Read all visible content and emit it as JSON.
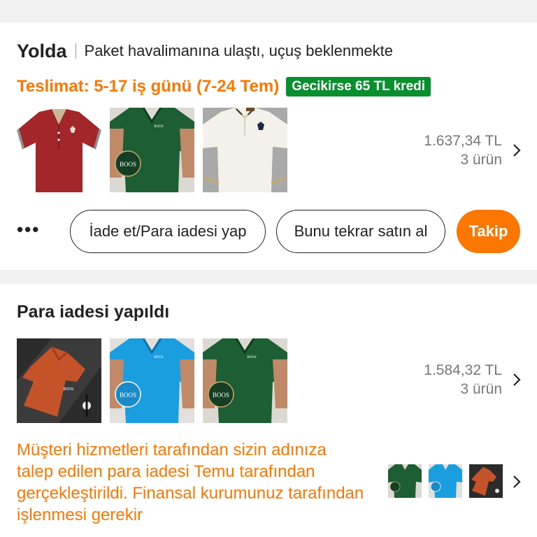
{
  "order1": {
    "status": "Yolda",
    "status_detail": "Paket havalimanına ulaştı, uçuş beklenmekte",
    "delivery": "Teslimat: 5-17 iş günü (7-24 Tem)",
    "badge": "Gecikirse 65 TL kredi",
    "products": [
      {
        "image": "red polo shirt",
        "color": "#a3262a"
      },
      {
        "image": "green polo shirt",
        "color": "#1d5e35",
        "logo_text": "BOOS"
      },
      {
        "image": "white polo shirt",
        "color": "#f4f1ea"
      }
    ],
    "price": "1.637,34 TL",
    "item_count": "3 ürün",
    "more_icon": "more-dots-icon",
    "return_label": "İade et/Para iadesi yap",
    "rebuy_label": "Bunu tekrar satın al",
    "follow_label": "Takip"
  },
  "order2": {
    "status": "Para iadesi yapıldı",
    "products": [
      {
        "image": "orange polo shirt in box",
        "color": "#c4532a"
      },
      {
        "image": "blue polo shirt",
        "color": "#1a9ee0",
        "logo_text": "BOOS"
      },
      {
        "image": "green polo shirt",
        "color": "#1d5e35",
        "logo_text": "BOOS"
      }
    ],
    "price": "1.584,32 TL",
    "item_count": "3 ürün",
    "refund_message": "Müşteri hizmetleri tarafından sizin adınıza talep edilen para iadesi Temu tarafından gerçekleştirildi. Finansal kurumunuz tarafından işlenmesi gerekir"
  },
  "colors": {
    "accent": "#fb7701",
    "badge_green": "#0a8f2e"
  }
}
